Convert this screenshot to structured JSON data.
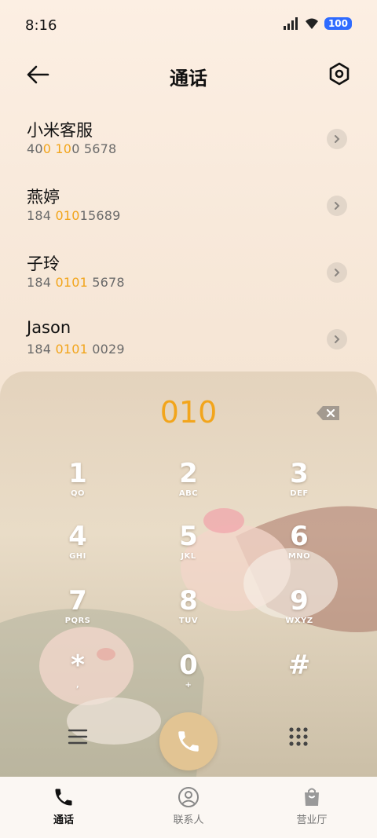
{
  "status_bar": {
    "time": "8:16",
    "battery": "100"
  },
  "header": {
    "title": "通话",
    "back_icon": "arrow-left-icon",
    "settings_icon": "hexagon-settings-icon"
  },
  "contacts": [
    {
      "name": "小米客服",
      "number_parts": [
        "40",
        "0 10",
        "0 5678"
      ]
    },
    {
      "name": "燕婷",
      "number_parts": [
        "184 ",
        "010",
        "15689"
      ]
    },
    {
      "name": "子玲",
      "number_parts": [
        "184 ",
        "0101",
        " 5678"
      ]
    },
    {
      "name": "Jason",
      "number_parts": [
        "184 ",
        "0101",
        " 0029"
      ]
    }
  ],
  "dialer": {
    "dialed": "010",
    "keys": [
      {
        "digit": "1",
        "letters": "QO"
      },
      {
        "digit": "2",
        "letters": "ABC"
      },
      {
        "digit": "3",
        "letters": "DEF"
      },
      {
        "digit": "4",
        "letters": "GHI"
      },
      {
        "digit": "5",
        "letters": "JKL"
      },
      {
        "digit": "6",
        "letters": "MNO"
      },
      {
        "digit": "7",
        "letters": "PQRS"
      },
      {
        "digit": "8",
        "letters": "TUV"
      },
      {
        "digit": "9",
        "letters": "WXYZ"
      },
      {
        "digit": "*",
        "letters": ","
      },
      {
        "digit": "0",
        "letters": "+"
      },
      {
        "digit": "#",
        "letters": ""
      }
    ]
  },
  "bottom_nav": [
    {
      "label": "通话",
      "icon": "phone-icon",
      "active": true
    },
    {
      "label": "联系人",
      "icon": "contact-icon",
      "active": false
    },
    {
      "label": "营业厅",
      "icon": "shopping-bag-icon",
      "active": false
    }
  ],
  "colors": {
    "accent": "#f2a51c",
    "call_button": "#e2c493"
  }
}
